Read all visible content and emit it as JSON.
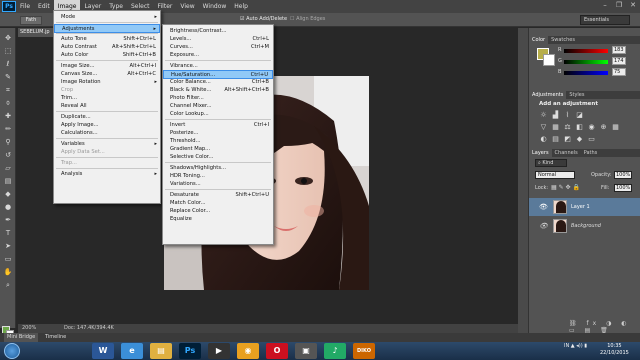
{
  "app": {
    "logo": "Ps",
    "menus": [
      "File",
      "Edit",
      "Image",
      "Layer",
      "Type",
      "Select",
      "Filter",
      "View",
      "Window",
      "Help"
    ],
    "active_menu": "Image",
    "window_controls": [
      "–",
      "❐",
      "✕"
    ]
  },
  "options": {
    "tool_label": "Fath",
    "auto_add": "Auto Add/Delete",
    "align_edges": "Align Edges",
    "workspace": "Essentials"
  },
  "document": {
    "tab": "SEBELUM.jp",
    "zoom": "200%",
    "info": "Doc: 147.4K/394.4K"
  },
  "image_menu": [
    {
      "label": "Mode",
      "submenu": true
    },
    {
      "sep": true
    },
    {
      "label": "Adjustments",
      "submenu": true,
      "highlight": true
    },
    {
      "sep": true
    },
    {
      "label": "Auto Tone",
      "shortcut": "Shift+Ctrl+L"
    },
    {
      "label": "Auto Contrast",
      "shortcut": "Alt+Shift+Ctrl+L"
    },
    {
      "label": "Auto Color",
      "shortcut": "Shift+Ctrl+B"
    },
    {
      "sep": true
    },
    {
      "label": "Image Size...",
      "shortcut": "Alt+Ctrl+I"
    },
    {
      "label": "Canvas Size...",
      "shortcut": "Alt+Ctrl+C"
    },
    {
      "label": "Image Rotation",
      "submenu": true
    },
    {
      "label": "Crop",
      "disabled": true
    },
    {
      "label": "Trim..."
    },
    {
      "label": "Reveal All"
    },
    {
      "sep": true
    },
    {
      "label": "Duplicate..."
    },
    {
      "label": "Apply Image..."
    },
    {
      "label": "Calculations..."
    },
    {
      "sep": true
    },
    {
      "label": "Variables",
      "submenu": true
    },
    {
      "label": "Apply Data Set...",
      "disabled": true
    },
    {
      "sep": true
    },
    {
      "label": "Trap...",
      "disabled": true
    },
    {
      "sep": true
    },
    {
      "label": "Analysis",
      "submenu": true
    }
  ],
  "adjust_menu": [
    {
      "label": "Brightness/Contrast..."
    },
    {
      "label": "Levels...",
      "shortcut": "Ctrl+L"
    },
    {
      "label": "Curves...",
      "shortcut": "Ctrl+M"
    },
    {
      "label": "Exposure..."
    },
    {
      "sep": true
    },
    {
      "label": "Vibrance..."
    },
    {
      "label": "Hue/Saturation...",
      "shortcut": "Ctrl+U",
      "highlight": true
    },
    {
      "label": "Color Balance...",
      "shortcut": "Ctrl+B"
    },
    {
      "label": "Black & White...",
      "shortcut": "Alt+Shift+Ctrl+B"
    },
    {
      "label": "Photo Filter..."
    },
    {
      "label": "Channel Mixer..."
    },
    {
      "label": "Color Lookup..."
    },
    {
      "sep": true
    },
    {
      "label": "Invert",
      "shortcut": "Ctrl+I"
    },
    {
      "label": "Posterize..."
    },
    {
      "label": "Threshold..."
    },
    {
      "label": "Gradient Map..."
    },
    {
      "label": "Selective Color..."
    },
    {
      "sep": true
    },
    {
      "label": "Shadows/Highlights..."
    },
    {
      "label": "HDR Toning..."
    },
    {
      "label": "Variations..."
    },
    {
      "sep": true
    },
    {
      "label": "Desaturate",
      "shortcut": "Shift+Ctrl+U"
    },
    {
      "label": "Match Color..."
    },
    {
      "label": "Replace Color..."
    },
    {
      "label": "Equalize"
    }
  ],
  "color_panel": {
    "tabs": [
      "Color",
      "Swatches"
    ],
    "channels": [
      {
        "name": "R",
        "value": "183"
      },
      {
        "name": "G",
        "value": "174"
      },
      {
        "name": "B",
        "value": "75"
      }
    ]
  },
  "adjust_panel": {
    "tabs": [
      "Adjustments",
      "Styles"
    ],
    "title": "Add an adjustment"
  },
  "layers_panel": {
    "tabs": [
      "Layers",
      "Channels",
      "Paths"
    ],
    "kind": "Kind",
    "blend": "Normal",
    "opacity_label": "Opacity:",
    "opacity": "100%",
    "lock_label": "Lock:",
    "fill_label": "Fill:",
    "fill": "100%",
    "layers": [
      {
        "name": "Layer 1",
        "selected": true
      },
      {
        "name": "Background"
      }
    ]
  },
  "bottom": {
    "mini_bridge": "Mini Bridge",
    "timeline": "Timeline"
  },
  "tray": {
    "lang": "IN",
    "time": "10:35",
    "date": "22/10/2015"
  },
  "taskbar_apps": [
    {
      "icon": "W",
      "color": "#2b5797"
    },
    {
      "icon": "e",
      "color": "#3b8fd8"
    },
    {
      "icon": "▤",
      "color": "#e0b040"
    },
    {
      "icon": "Ps",
      "color": "#001e36"
    },
    {
      "icon": "▶",
      "color": "#333"
    },
    {
      "icon": "◉",
      "color": "#e8a020"
    },
    {
      "icon": "O",
      "color": "#cc1020"
    },
    {
      "icon": "▣",
      "color": "#555"
    },
    {
      "icon": "♪",
      "color": "#2a6"
    },
    {
      "icon": "DIKO",
      "color": "#c60"
    }
  ]
}
